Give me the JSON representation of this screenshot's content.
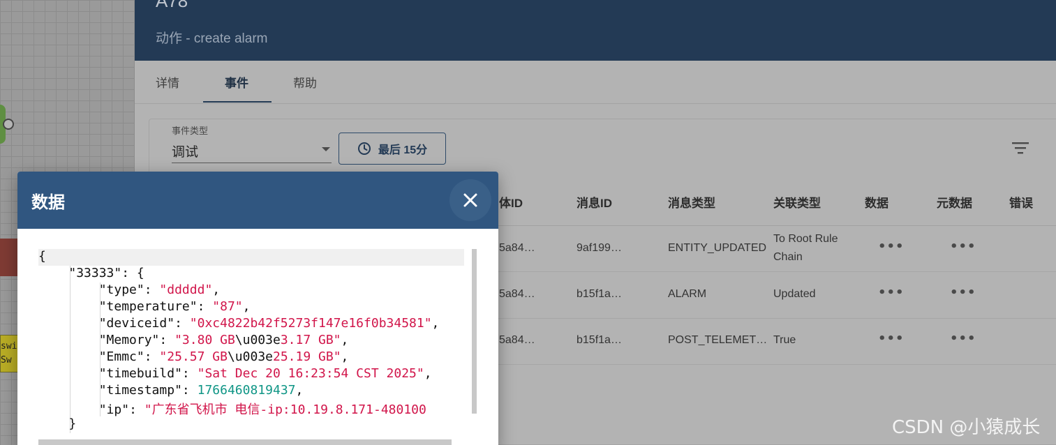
{
  "canvas": {
    "yellow_node_lines": [
      "swit",
      "Sw"
    ]
  },
  "node": {
    "name": "A78",
    "subtitle": "动作 - create alarm"
  },
  "tabs": [
    {
      "label": "详情",
      "active": false
    },
    {
      "label": "事件",
      "active": true
    },
    {
      "label": "帮助",
      "active": false
    }
  ],
  "filters": {
    "event_type_label": "事件类型",
    "event_type_value": "调试",
    "time_button_label": "最后 15分"
  },
  "table": {
    "columns": [
      "体ID",
      "消息ID",
      "消息类型",
      "关联类型",
      "数据",
      "元数据",
      "错误"
    ],
    "rows": [
      {
        "entity_id": "5a84…",
        "message_id": "9af199…",
        "message_type": "ENTITY_UPDATED",
        "relation_line1": "To Root Rule",
        "relation_line2": "Chain",
        "data": "•••",
        "metadata": "•••"
      },
      {
        "entity_id": "5a84…",
        "message_id": "b15f1a…",
        "message_type": "ALARM",
        "relation_line1": "Updated",
        "relation_line2": "",
        "data": "•••",
        "metadata": "•••"
      },
      {
        "entity_id": "5a84…",
        "message_id": "b15f1a…",
        "message_type": "POST_TELEMET…",
        "relation_line1": "True",
        "relation_line2": "",
        "data": "•••",
        "metadata": "•••"
      }
    ]
  },
  "dialog": {
    "title": "数据",
    "close_icon": "close-icon",
    "json": {
      "open_brace": "{",
      "key_33333": "\"33333\"",
      "type_key": "\"type\"",
      "type_val": "\"ddddd\"",
      "temperature_key": "\"temperature\"",
      "temperature_val": "\"87\"",
      "deviceid_key": "\"deviceid\"",
      "deviceid_val": "\"0xc4822b42f5273f147e16f0b34581\"",
      "memory_key": "\"Memory\"",
      "memory_val_a": "\"3.80 GB",
      "memory_esc": "\\u003e",
      "memory_val_b": "3.17 GB\"",
      "emmc_key": "\"Emmc\"",
      "emmc_val_a": "\"25.57 GB",
      "emmc_esc": "\\u003e",
      "emmc_val_b": "25.19 GB\"",
      "timebuild_key": "\"timebuild\"",
      "timebuild_val": "\"Sat Dec 20 16:23:54 CST 2025\"",
      "timestamp_key": "\"timestamp\"",
      "timestamp_val": "1766460819437",
      "ip_key": "\"ip\"",
      "ip_val": "\"广东省飞机市 电信-ip:10.19.8.171-480100",
      "close_inner": "}"
    }
  },
  "watermark": "CSDN @小猿成长",
  "colors": {
    "header_bg": "#233a55",
    "dialog_header_bg": "#305680",
    "json_string": "#d1154a",
    "json_number": "#109686"
  }
}
